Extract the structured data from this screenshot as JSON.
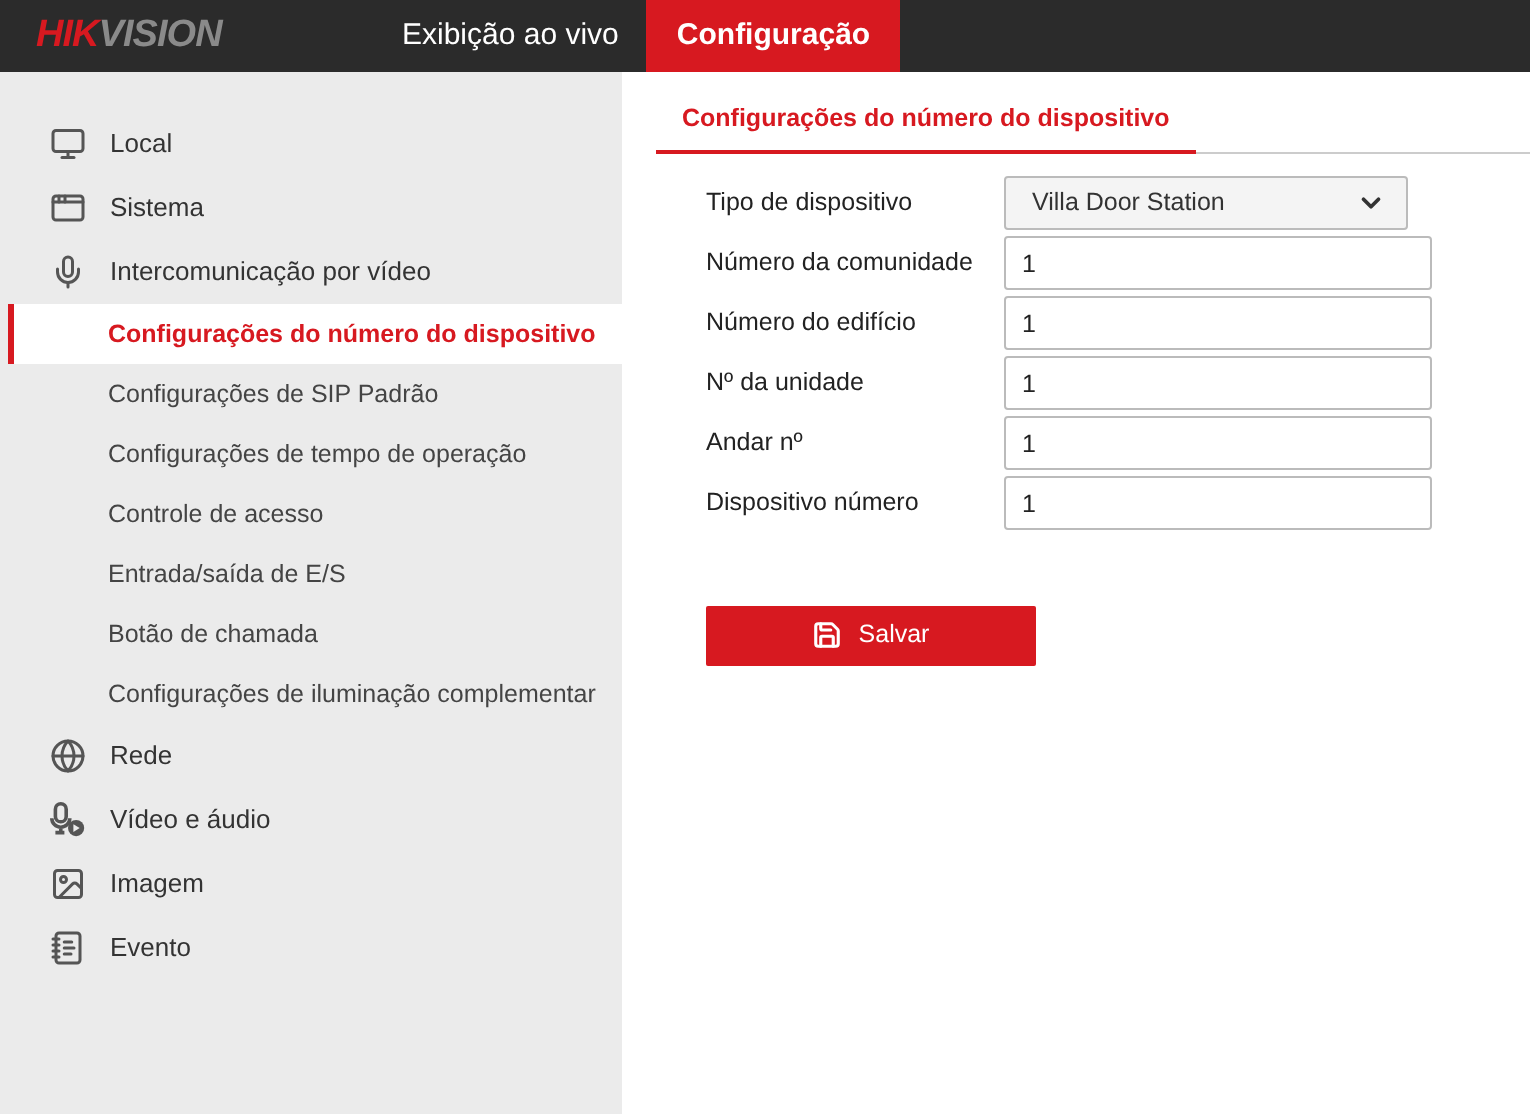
{
  "header": {
    "logo": [
      "HIK",
      "VISION"
    ],
    "tabs": [
      {
        "label": "Exibição ao vivo",
        "selected": false
      },
      {
        "label": "Configuração",
        "selected": true
      }
    ]
  },
  "sidebar": {
    "items": [
      {
        "label": "Local",
        "selected": false
      },
      {
        "label": "Sistema",
        "selected": false
      },
      {
        "label": "Intercomunicação por vídeo",
        "selected": false,
        "children": [
          {
            "label": "Configurações do número do dispositivo",
            "selected": true
          },
          {
            "label": "Configurações de SIP Padrão",
            "selected": false
          },
          {
            "label": "Configurações de tempo de operação",
            "selected": false
          },
          {
            "label": "Controle de acesso",
            "selected": false
          },
          {
            "label": "Entrada/saída de E/S",
            "selected": false
          },
          {
            "label": "Botão de chamada",
            "selected": false
          },
          {
            "label": "Configurações de iluminação complementar",
            "selected": false
          }
        ]
      },
      {
        "label": "Rede",
        "selected": false
      },
      {
        "label": "Vídeo e áudio",
        "selected": false
      },
      {
        "label": "Imagem",
        "selected": false
      },
      {
        "label": "Evento",
        "selected": false
      }
    ]
  },
  "content": {
    "tabs": [
      {
        "label": "Configurações do número do dispositivo",
        "selected": true
      }
    ],
    "fields": [
      {
        "label": "Tipo de dispositivo",
        "kind": "select",
        "value": "Villa Door Station"
      },
      {
        "label": "Número da comunidade",
        "kind": "text",
        "value": "1"
      },
      {
        "label": "Número do edifício",
        "kind": "text",
        "value": "1"
      },
      {
        "label": "Nº da unidade",
        "kind": "text",
        "value": "1"
      },
      {
        "label": "Andar nº",
        "kind": "text",
        "value": "1"
      },
      {
        "label": "Dispositivo número",
        "kind": "text",
        "value": "1"
      }
    ],
    "save_button": "Salvar"
  }
}
